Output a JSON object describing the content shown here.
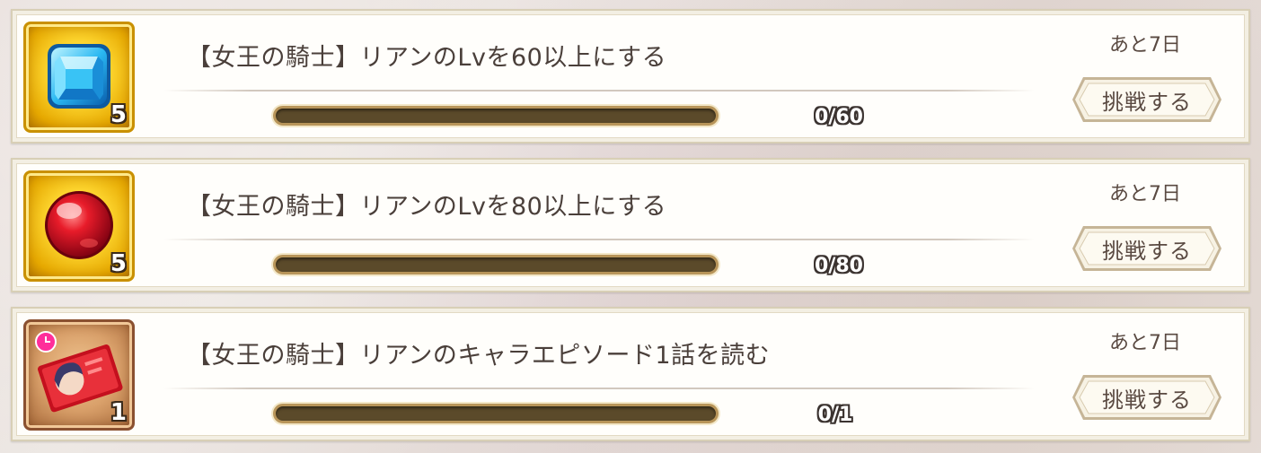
{
  "missions": [
    {
      "reward_icon": "blue-gem-icon",
      "reward_count": "5",
      "title": "【女王の騎士】リアンのLvを60以上にする",
      "progress_text": "0/60",
      "progress_fraction": 0,
      "remaining": "あと7日",
      "button_label": "挑戦する"
    },
    {
      "reward_icon": "red-orb-icon",
      "reward_count": "5",
      "title": "【女王の騎士】リアンのLvを80以上にする",
      "progress_text": "0/80",
      "progress_fraction": 0,
      "remaining": "あと7日",
      "button_label": "挑戦する"
    },
    {
      "reward_icon": "character-ticket-icon",
      "reward_count": "1",
      "title": "【女王の騎士】リアンのキャラエピソード1話を読む",
      "progress_text": "0/1",
      "progress_fraction": 0,
      "remaining": "あと7日",
      "button_label": "挑戦する"
    }
  ],
  "colors": {
    "panel_bg": "#fffefb",
    "bar_track": "#5b4a2a",
    "bar_border": "#b8955a",
    "text": "#4a3f3a"
  }
}
